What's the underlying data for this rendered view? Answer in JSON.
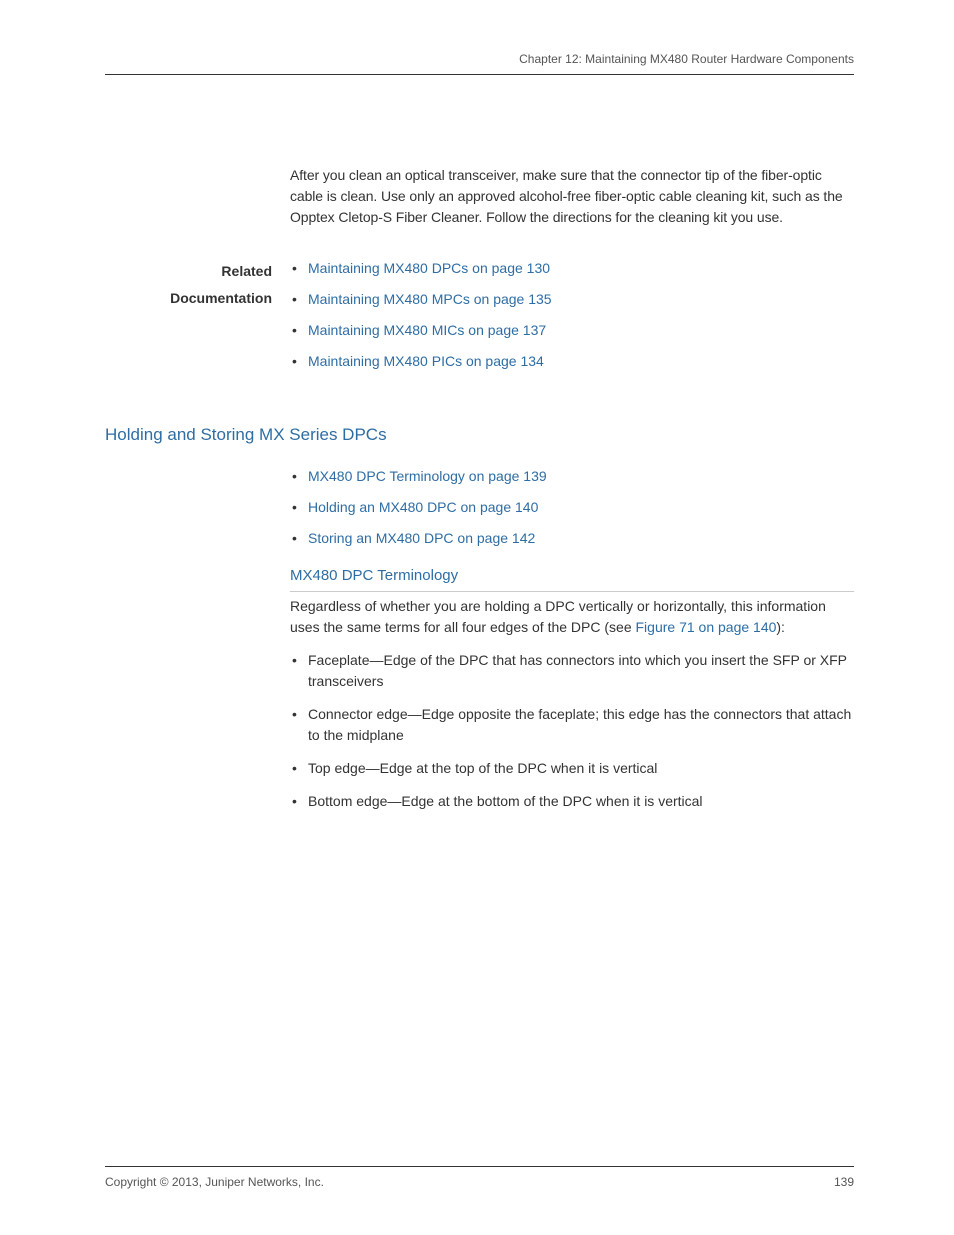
{
  "header": {
    "chapter": "Chapter 12: Maintaining MX480 Router Hardware Components"
  },
  "body": {
    "paragraph1": "After you clean an optical transceiver, make sure that the connector tip of the fiber-optic cable is clean. Use only an approved alcohol-free fiber-optic cable cleaning kit, such as the Opptex Cletop-S Fiber Cleaner. Follow the directions for the cleaning kit you use."
  },
  "related": {
    "label1": "Related",
    "label2": "Documentation",
    "items": [
      "Maintaining MX480 DPCs on page 130",
      "Maintaining MX480 MPCs on page 135",
      "Maintaining MX480 MICs on page 137",
      "Maintaining MX480 PICs on page 134"
    ]
  },
  "section": {
    "heading": "Holding and Storing MX Series DPCs",
    "intro_links": [
      "MX480 DPC Terminology on page 139",
      "Holding an MX480 DPC on page 140",
      "Storing an MX480 DPC on page 142"
    ],
    "subheading": "MX480 DPC Terminology",
    "para_pre": "Regardless of whether you are holding a DPC vertically or horizontally, this information uses the same terms for all four edges of the DPC (see ",
    "para_link": "Figure 71 on page 140",
    "para_post": "):",
    "terms": [
      "Faceplate—Edge of the DPC that has connectors into which you insert the SFP or XFP transceivers",
      "Connector edge—Edge opposite the faceplate; this edge has the connectors that attach to the midplane",
      "Top edge—Edge at the top of the DPC when it is vertical",
      "Bottom edge—Edge at the bottom of the DPC when it is vertical"
    ]
  },
  "footer": {
    "copyright": "Copyright © 2013, Juniper Networks, Inc.",
    "page": "139"
  }
}
